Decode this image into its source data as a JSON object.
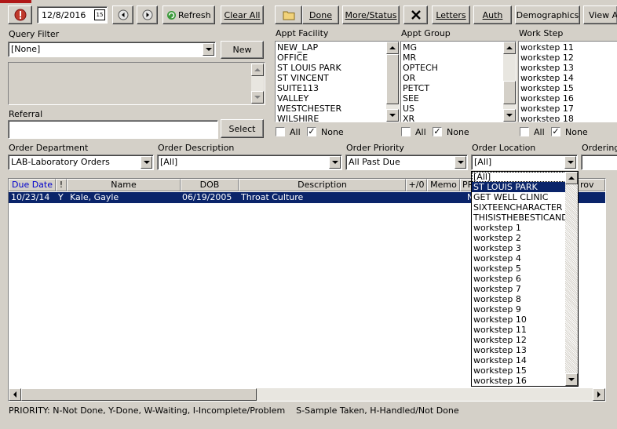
{
  "toolbar": {
    "date_value": "12/8/2016",
    "refresh_label": "Refresh",
    "clear_all_label": "Clear All",
    "done_label": "Done",
    "more_status_label": "More/Status",
    "letters_label": "Letters",
    "auth_label": "Auth",
    "demographics_label": "Demographics",
    "view_label": "View A"
  },
  "query_filter": {
    "label": "Query Filter",
    "value": "[None]",
    "new_label": "New"
  },
  "referral": {
    "label": "Referral",
    "value": "",
    "select_label": "Select"
  },
  "appt_facility": {
    "label": "Appt Facility",
    "items": [
      "NEW_LAP",
      "OFFICE",
      "ST LOUIS PARK",
      "ST VINCENT",
      "SUITE113",
      "VALLEY",
      "WESTCHESTER",
      "WILSHIRE"
    ],
    "all_label": "All",
    "none_label": "None",
    "all_checked": false,
    "none_checked": true
  },
  "appt_group": {
    "label": "Appt Group",
    "items": [
      "MG",
      "MR",
      "OPTECH",
      "OR",
      "PETCT",
      "SEE",
      "US",
      "XR"
    ],
    "all_label": "All",
    "none_label": "None",
    "all_checked": false,
    "none_checked": true
  },
  "work_step": {
    "label": "Work Step",
    "items": [
      "workstep 11",
      "workstep 12",
      "workstep 13",
      "workstep 14",
      "workstep 15",
      "workstep 16",
      "workstep 17",
      "workstep 18"
    ],
    "all_label": "All",
    "none_label": "None",
    "all_checked": false,
    "none_checked": true
  },
  "filters": {
    "order_department_label": "Order Department",
    "order_department_value": "LAB-Laboratory Orders",
    "order_description_label": "Order Description",
    "order_description_value": "[All]",
    "order_priority_label": "Order Priority",
    "order_priority_value": "All Past Due",
    "order_location_label": "Order Location",
    "order_location_value": "[All]",
    "ordering_label": "Ordering"
  },
  "table": {
    "headers": {
      "due_date": "Due Date",
      "flag": "!",
      "name": "Name",
      "dob": "DOB",
      "description": "Description",
      "plus0": "+/0",
      "memo": "Memo",
      "pr": "PR",
      "prov": "rov"
    },
    "rows": [
      {
        "due_date": "10/23/14",
        "flag": "Y",
        "name": "Kale, Gayle",
        "dob": "06/19/2005",
        "description": "Throat Culture",
        "pr": "N"
      }
    ]
  },
  "location_dropdown": {
    "items": [
      "[All]",
      "ST LOUIS PARK",
      "GET WELL CLINIC",
      "SIXTEENCHARACTER",
      "THISISTHEBESTICAND",
      "workstep 1",
      "workstep 2",
      "workstep 3",
      "workstep 4",
      "workstep 5",
      "workstep 6",
      "workstep 7",
      "workstep 8",
      "workstep 9",
      "workstep 10",
      "workstep 11",
      "workstep 12",
      "workstep 13",
      "workstep 14",
      "workstep 15",
      "workstep 16"
    ],
    "selected_index": 1
  },
  "status_bar": {
    "legend": "PRIORITY: N-Not Done, Y-Done, W-Waiting, I-Incomplete/Problem    S-Sample Taken, H-Handled/Not Done"
  },
  "colors": {
    "face": "#d4d0c8",
    "selection": "#0a246a",
    "alert_red": "#c0392b",
    "header_link": "#0000cc"
  }
}
